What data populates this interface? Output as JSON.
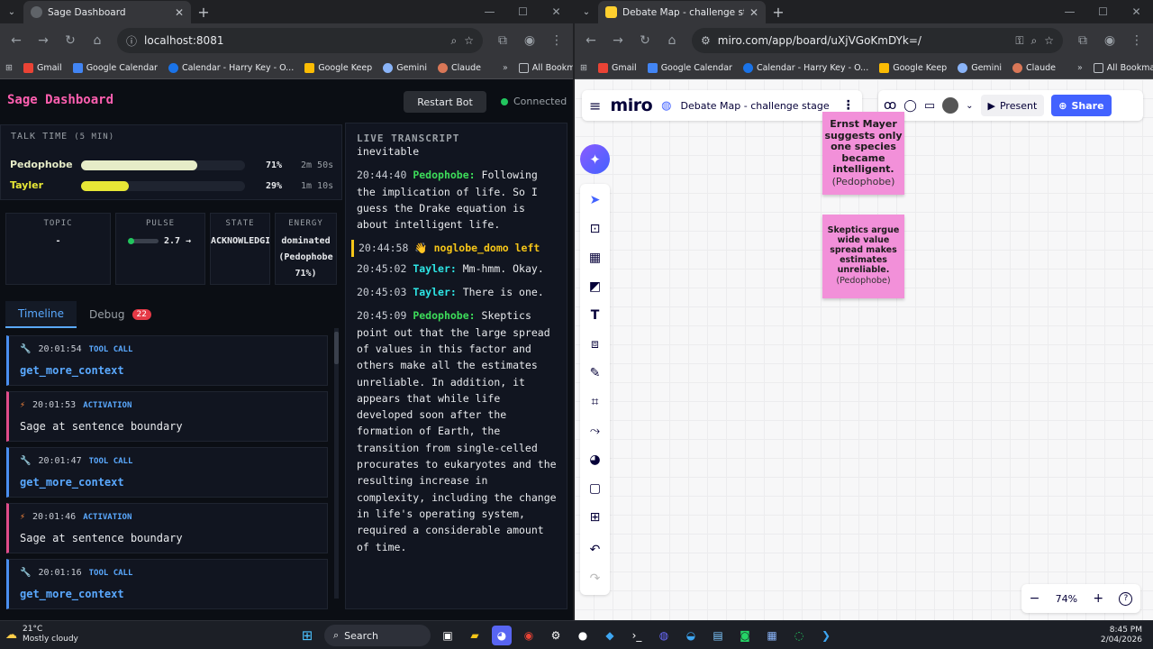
{
  "left_browser": {
    "tab_title": "Sage Dashboard",
    "url": "localhost:8081",
    "bookmarks": [
      "Gmail",
      "Google Calendar",
      "Calendar - Harry Key - O...",
      "Google Keep",
      "Gemini",
      "Claude"
    ],
    "all_bookmarks": "All Bookmarks"
  },
  "right_browser": {
    "tab_title": "Debate Map - challenge stage - Miro",
    "url": "miro.com/app/board/uXjVGoKmDYk=/",
    "bookmarks": [
      "Gmail",
      "Google Calendar",
      "Calendar - Harry Key - O...",
      "Google Keep",
      "Gemini",
      "Claude"
    ],
    "all_bookmarks": "All Bookmarks"
  },
  "sage": {
    "title": "Sage Dashboard",
    "restart_label": "Restart Bot",
    "status": "Connected",
    "talk_time_label": "TALK TIME",
    "talk_time_window": "(5 MIN)",
    "speakers": [
      {
        "name": "Pedophobe",
        "percent": "71%",
        "duration": "2m 50s",
        "fraction": 0.71,
        "color": "#e6ecc8"
      },
      {
        "name": "Tayler",
        "percent": "29%",
        "duration": "1m 10s",
        "fraction": 0.29,
        "color": "#e7e736"
      }
    ],
    "stats": {
      "topic_label": "TOPIC",
      "topic_value": "-",
      "pulse_label": "PULSE",
      "pulse_value": "2.7 →",
      "state_label": "STATE",
      "state_value": "ACKNOWLEDGI",
      "energy_label": "ENERGY",
      "energy_value": "dominated (Pedophobe 71%)"
    },
    "tabs": {
      "timeline": "Timeline",
      "debug": "Debug",
      "debug_count": "22"
    },
    "timeline": [
      {
        "type": "tool",
        "icon": "wrench-icon",
        "time": "20:01:54",
        "kind": "TOOL CALL",
        "value": "get_more_context"
      },
      {
        "type": "act",
        "icon": "lightning-icon",
        "time": "20:01:53",
        "kind": "ACTIVATION",
        "value": "Sage at sentence boundary"
      },
      {
        "type": "tool",
        "icon": "wrench-icon",
        "time": "20:01:47",
        "kind": "TOOL CALL",
        "value": "get_more_context"
      },
      {
        "type": "act",
        "icon": "lightning-icon",
        "time": "20:01:46",
        "kind": "ACTIVATION",
        "value": "Sage at sentence boundary"
      },
      {
        "type": "tool",
        "icon": "wrench-icon",
        "time": "20:01:16",
        "kind": "TOOL CALL",
        "value": "get_more_context"
      }
    ],
    "transcript_label": "LIVE TRANSCRIPT",
    "transcript_top": "inevitable",
    "transcript": [
      {
        "time": "20:44:40",
        "speaker": "Pedophobe:",
        "speaker_class": "p",
        "text": "Following the implication of life. So I guess the Drake equation is about intelligent life."
      },
      {
        "time": "20:44:58",
        "event": "noglobe_domo left"
      },
      {
        "time": "20:45:02",
        "speaker": "Tayler:",
        "speaker_class": "t",
        "text": "Mm-hmm. Okay."
      },
      {
        "time": "20:45:03",
        "speaker": "Tayler:",
        "speaker_class": "t",
        "text": "There is one."
      },
      {
        "time": "20:45:09",
        "speaker": "Pedophobe:",
        "speaker_class": "p",
        "text": "Skeptics point out that the large spread of values in this factor and others make all the estimates unreliable. In addition, it appears that while life developed soon after the formation of Earth, the transition from single-celled procurates to eukaryotes and the resulting increase in complexity, including the change in life's operating system, required a considerable amount of time."
      }
    ]
  },
  "miro": {
    "logo": "miro",
    "board_name": "Debate Map - challenge stage",
    "present_label": "Present",
    "share_label": "Share",
    "zoom_level": "74%",
    "stickies": [
      {
        "text": "Ernst Mayer suggests only one species became intelligent.",
        "author": "(Pedophobe)"
      },
      {
        "text": "Skeptics argue wide value spread makes estimates unreliable.",
        "author": "(Pedophobe)"
      }
    ]
  },
  "taskbar": {
    "temperature": "21°C",
    "weather": "Mostly cloudy",
    "search_label": "Search",
    "time": "8:45 PM",
    "date": "2/04/2026"
  }
}
